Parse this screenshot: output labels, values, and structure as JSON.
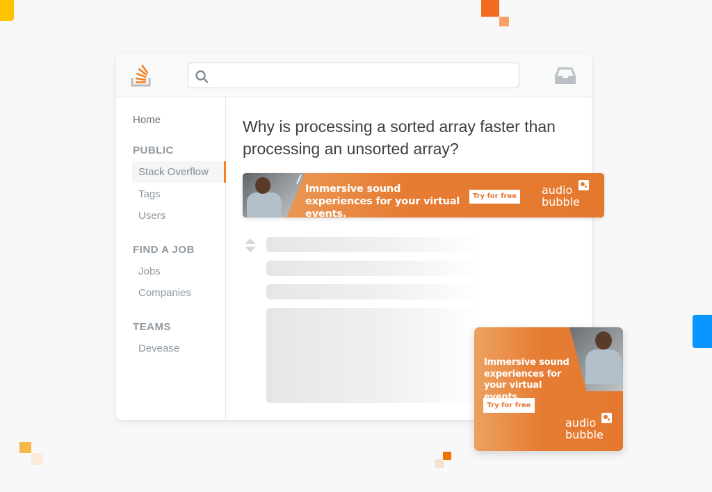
{
  "header": {
    "logo_icon": "stackoverflow-logo-icon",
    "search": {
      "value": "",
      "placeholder": "",
      "icon": "search-icon"
    },
    "inbox_icon": "inbox-icon"
  },
  "sidebar": {
    "home": "Home",
    "sections": [
      {
        "heading": "PUBLIC",
        "items": [
          "Stack Overflow",
          "Tags",
          "Users"
        ]
      },
      {
        "heading": "FIND A JOB",
        "items": [
          "Jobs",
          "Companies"
        ]
      },
      {
        "heading": "TEAMS",
        "items": [
          "Devease"
        ]
      }
    ],
    "active_item": "Stack Overflow"
  },
  "main": {
    "question_title": "Why is processing a sorted array faster than processing an unsorted array?",
    "vote_icon": "vote-arrows-icon"
  },
  "ads": {
    "banner": {
      "headline": "Immersive sound experiences for your virtual events.",
      "cta": "Try for free",
      "brand_line1": "audio",
      "brand_line2": "bubble"
    },
    "card": {
      "headline": "Immersive sound experiences for your virtual events.",
      "cta": "Try for free",
      "brand_line1": "audio",
      "brand_line2": "bubble"
    }
  },
  "colors": {
    "accent": "#f48225",
    "ad_orange": "#e67c33",
    "background": "#f8f8f8",
    "deco_blue": "#0a95ff",
    "deco_yellow": "#ffc400"
  }
}
